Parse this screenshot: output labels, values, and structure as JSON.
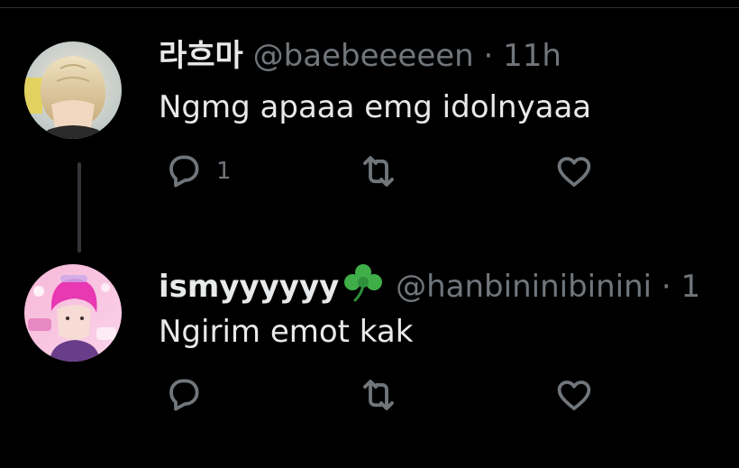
{
  "tweets": [
    {
      "display_name": "라흐마",
      "handle": "@baebeeeeen",
      "separator": "·",
      "time": "11h",
      "text": "Ngmg apaaa emg idolnyaaa",
      "reply_count": "1",
      "avatar_icon": "avatar-blond-person"
    },
    {
      "display_name": "ismyyyyyy",
      "name_emoji": "shamrock",
      "handle": "@hanbininibinini",
      "separator": "·",
      "time": "1",
      "text": "Ngirim emot kak",
      "reply_count": "",
      "avatar_icon": "avatar-pink-hair-person"
    }
  ],
  "colors": {
    "background": "#000000",
    "text_primary": "#e7e9ea",
    "text_secondary": "#71767b",
    "thread_line": "#333639",
    "clover_green": "#3fae49"
  },
  "icons": [
    "reply-icon",
    "retweet-icon",
    "like-icon"
  ]
}
